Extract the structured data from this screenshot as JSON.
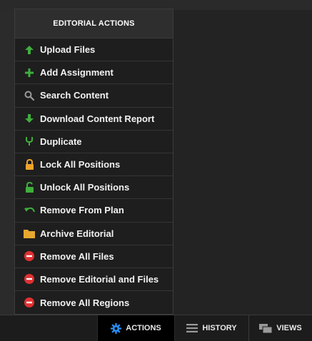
{
  "menu": {
    "title": "EDITORIAL ACTIONS",
    "items": [
      {
        "label": "Upload Files",
        "icon": "upload-arrow-icon",
        "color": "#3fae3c"
      },
      {
        "label": "Add Assignment",
        "icon": "plus-icon",
        "color": "#3fae3c"
      },
      {
        "label": "Search Content",
        "icon": "search-icon",
        "color": "#9a9a9a"
      },
      {
        "label": "Download Content Report",
        "icon": "download-arrow-icon",
        "color": "#3fae3c"
      },
      {
        "label": "Duplicate",
        "icon": "fork-icon",
        "color": "#3fae3c"
      },
      {
        "label": "Lock All Positions",
        "icon": "lock-icon",
        "color": "#f0a32b"
      },
      {
        "label": "Unlock All Positions",
        "icon": "unlock-icon",
        "color": "#3fae3c"
      },
      {
        "label": "Remove From Plan",
        "icon": "undo-icon",
        "color": "#3fae3c"
      },
      {
        "label": "Archive Editorial",
        "icon": "folder-icon",
        "color": "#e6a82f"
      },
      {
        "label": "Remove All Files",
        "icon": "minus-circle-icon",
        "color": "#e03030"
      },
      {
        "label": "Remove Editorial and Files",
        "icon": "minus-circle-icon",
        "color": "#e03030"
      },
      {
        "label": "Remove All Regions",
        "icon": "minus-circle-icon",
        "color": "#e03030"
      }
    ]
  },
  "bottom_bar": {
    "actions_label": "ACTIONS",
    "history_label": "HISTORY",
    "views_label": "VIEWS",
    "active_tab": "ACTIONS",
    "accent": "#2a8ff7"
  }
}
